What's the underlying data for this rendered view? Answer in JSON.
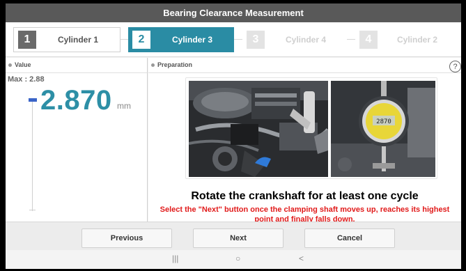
{
  "window": {
    "title": "Bearing Clearance Measurement"
  },
  "steps": [
    {
      "num": "1",
      "label": "Cylinder 1",
      "state": "done"
    },
    {
      "num": "2",
      "label": "Cylinder 3",
      "state": "active"
    },
    {
      "num": "3",
      "label": "Cylinder 4",
      "state": "todo"
    },
    {
      "num": "4",
      "label": "Cylinder 2",
      "state": "todo"
    }
  ],
  "value_panel": {
    "title": "Value",
    "max_label": "Max : 2.88",
    "value": "2.870",
    "unit": "mm"
  },
  "preparation": {
    "title": "Preparation",
    "help_glyph": "?",
    "instruction": "Rotate the crankshaft for at least one cycle",
    "warning": "Select the \"Next\" button once the clamping shaft moves up, reaches its highest point and finally falls down."
  },
  "buttons": {
    "previous": "Previous",
    "next": "Next",
    "cancel": "Cancel"
  },
  "system_nav": {
    "recents": "|||",
    "home": "○",
    "back": "<"
  },
  "colors": {
    "accent": "#2a8ca4",
    "warning": "#e11a1a",
    "title_bar": "#595959",
    "marker": "#3a64c8"
  }
}
